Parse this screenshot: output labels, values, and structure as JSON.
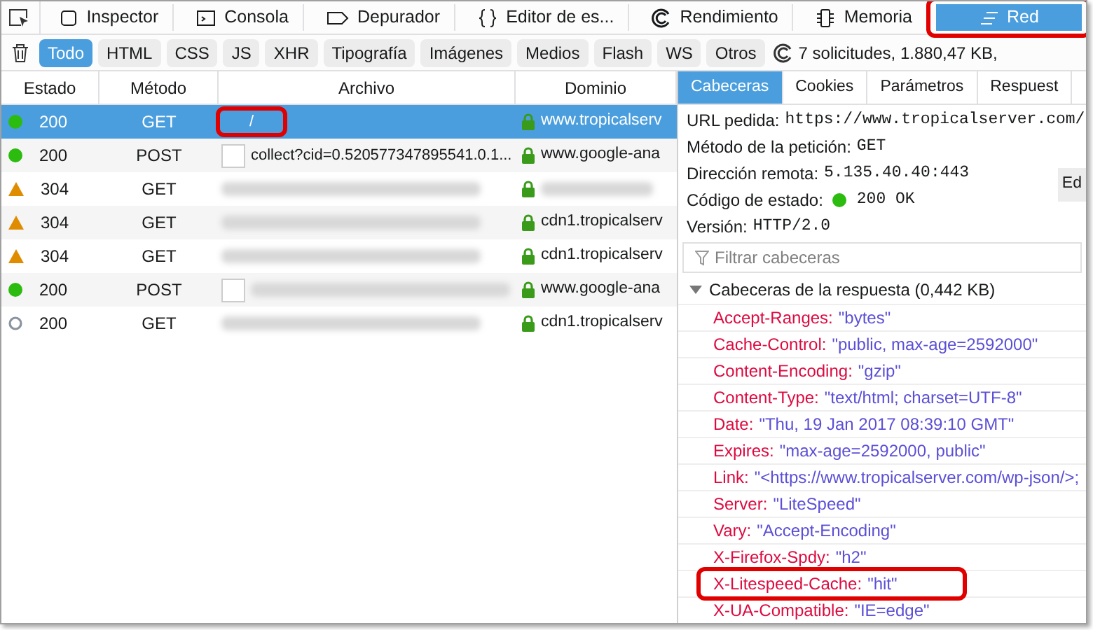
{
  "toolbar": {
    "tabs": [
      {
        "label": "Inspector",
        "selected": false
      },
      {
        "label": "Consola",
        "selected": false
      },
      {
        "label": "Depurador",
        "selected": false
      },
      {
        "label": "Editor de es...",
        "selected": false
      },
      {
        "label": "Rendimiento",
        "selected": false
      },
      {
        "label": "Memoria",
        "selected": false
      },
      {
        "label": "Red",
        "selected": true,
        "highlighted": true
      }
    ]
  },
  "filters": {
    "buttons": [
      {
        "label": "Todo",
        "selected": true
      },
      {
        "label": "HTML",
        "selected": false
      },
      {
        "label": "CSS",
        "selected": false
      },
      {
        "label": "JS",
        "selected": false
      },
      {
        "label": "XHR",
        "selected": false
      },
      {
        "label": "Tipografía",
        "selected": false
      },
      {
        "label": "Imágenes",
        "selected": false
      },
      {
        "label": "Medios",
        "selected": false
      },
      {
        "label": "Flash",
        "selected": false
      },
      {
        "label": "WS",
        "selected": false
      },
      {
        "label": "Otros",
        "selected": false
      }
    ],
    "summary": "7 solicitudes, 1.880,47 KB,"
  },
  "table": {
    "columns": [
      "Estado",
      "Método",
      "Archivo",
      "Dominio"
    ],
    "rows": [
      {
        "kind": "ok",
        "status": "200",
        "method": "GET",
        "file": "/",
        "domain": "www.tropicalserv",
        "selected": true,
        "highlighted": true
      },
      {
        "kind": "ok",
        "status": "200",
        "method": "POST",
        "file": "collect?cid=0.520577347895541.0.1...",
        "thumbnail": true,
        "domain": "www.google-ana",
        "selected": false
      },
      {
        "kind": "cached",
        "status": "304",
        "method": "GET",
        "selected": false
      },
      {
        "kind": "cached",
        "status": "304",
        "method": "GET",
        "domain": "cdn1.tropicalserv",
        "selected": false
      },
      {
        "kind": "cached",
        "status": "304",
        "method": "GET",
        "domain": "cdn1.tropicalserv",
        "selected": false
      },
      {
        "kind": "ok",
        "status": "200",
        "method": "POST",
        "thumbnail": true,
        "domain": "www.google-ana",
        "selected": false
      },
      {
        "kind": "pending",
        "status": "200",
        "method": "GET",
        "domain": "cdn1.tropicalserv",
        "selected": false
      }
    ]
  },
  "details": {
    "tabs": [
      {
        "label": "Cabeceras",
        "selected": true
      },
      {
        "label": "Cookies",
        "selected": false
      },
      {
        "label": "Parámetros",
        "selected": false
      },
      {
        "label": "Respuest",
        "selected": false
      }
    ],
    "summary": [
      {
        "label": "URL pedida:",
        "value": "https://www.tropicalserver.com/"
      },
      {
        "label": "Método de la petición:",
        "value": "GET"
      },
      {
        "label": "Dirección remota:",
        "value": "5.135.40.40:443"
      },
      {
        "label": "Código de estado:",
        "value": "200 OK",
        "status_dot": true
      },
      {
        "label": "Versión:",
        "value": "HTTP/2.0"
      }
    ],
    "edit_button": "Ed",
    "filter": {
      "placeholder": "Filtrar cabeceras"
    },
    "section": {
      "title": "Cabeceras de la respuesta (0,442 KB)",
      "expanded": true,
      "headers": [
        {
          "name": "Accept-Ranges:",
          "value": "\"bytes\""
        },
        {
          "name": "Cache-Control:",
          "value": "\"public, max-age=2592000\""
        },
        {
          "name": "Content-Encoding:",
          "value": "\"gzip\""
        },
        {
          "name": "Content-Type:",
          "value": "\"text/html; charset=UTF-8\""
        },
        {
          "name": "Date:",
          "value": "\"Thu, 19 Jan 2017 08:39:10 GMT\""
        },
        {
          "name": "Expires:",
          "value": "\"max-age=2592000, public\""
        },
        {
          "name": "Link:",
          "value": "\"<https://www.tropicalserver.com/wp-json/>;"
        },
        {
          "name": "Server:",
          "value": "\"LiteSpeed\""
        },
        {
          "name": "Vary:",
          "value": "\"Accept-Encoding\""
        },
        {
          "name": "X-Firefox-Spdy:",
          "value": "\"h2\""
        },
        {
          "name": "X-Litespeed-Cache:",
          "value": "\"hit\"",
          "highlighted": true
        },
        {
          "name": "X-UA-Compatible:",
          "value": "\"IE=edge\""
        }
      ]
    }
  }
}
